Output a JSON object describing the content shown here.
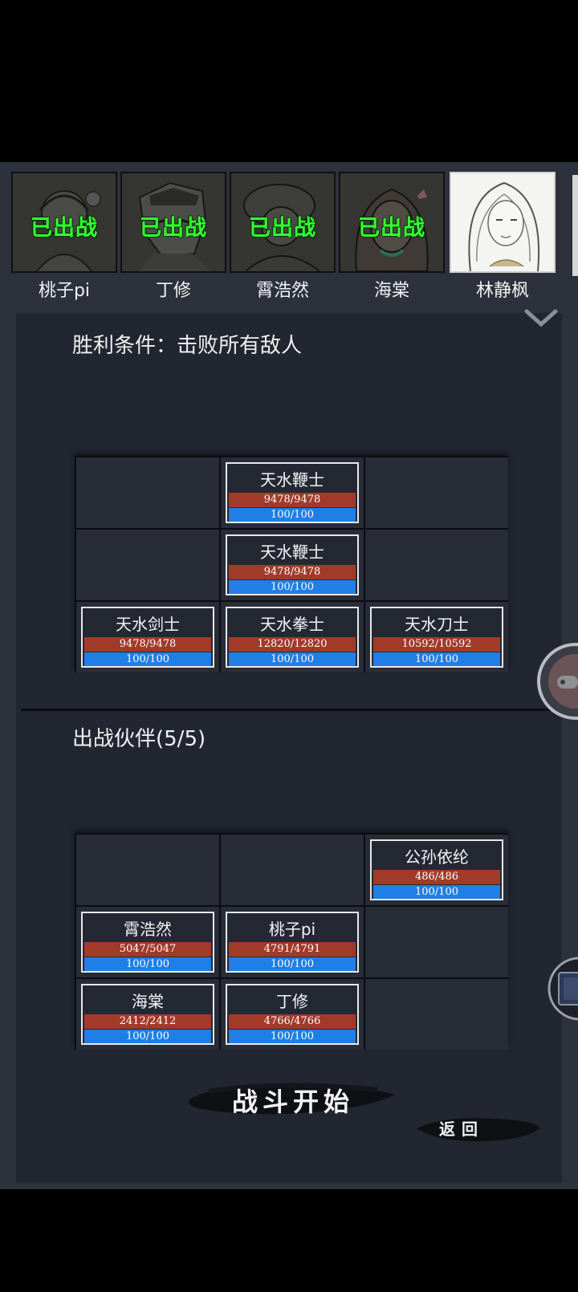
{
  "roster": [
    {
      "name": "桃子pi",
      "status": "已出战"
    },
    {
      "name": "丁修",
      "status": "已出战"
    },
    {
      "name": "霄浩然",
      "status": "已出战"
    },
    {
      "name": "海棠",
      "status": "已出战"
    },
    {
      "name": "林静枫",
      "status": ""
    }
  ],
  "enemy_section": {
    "title": "胜利条件：击败所有敌人",
    "units": [
      {
        "name": "天水鞭士",
        "hp": "9478/9478",
        "mp": "100/100"
      },
      {
        "name": "天水鞭士",
        "hp": "9478/9478",
        "mp": "100/100"
      },
      {
        "name": "天水剑士",
        "hp": "9478/9478",
        "mp": "100/100"
      },
      {
        "name": "天水拳士",
        "hp": "12820/12820",
        "mp": "100/100"
      },
      {
        "name": "天水刀士",
        "hp": "10592/10592",
        "mp": "100/100"
      }
    ]
  },
  "ally_section": {
    "title": "出战伙伴(5/5)",
    "units": [
      {
        "name": "公孙依纶",
        "hp": "486/486",
        "mp": "100/100"
      },
      {
        "name": "霄浩然",
        "hp": "5047/5047",
        "mp": "100/100"
      },
      {
        "name": "桃子pi",
        "hp": "4791/4791",
        "mp": "100/100"
      },
      {
        "name": "海棠",
        "hp": "2412/2412",
        "mp": "100/100"
      },
      {
        "name": "丁修",
        "hp": "4766/4766",
        "mp": "100/100"
      }
    ]
  },
  "buttons": {
    "start": "战斗开始",
    "back": "返回"
  },
  "icons": {
    "collapse": "chevron-down-icon",
    "floating": "gamepad-icon",
    "card": "card-icon"
  },
  "colors": {
    "hp_bar": "#a23a2a",
    "mp_bar": "#1f7fe6",
    "deployed_text": "#35ff35"
  }
}
